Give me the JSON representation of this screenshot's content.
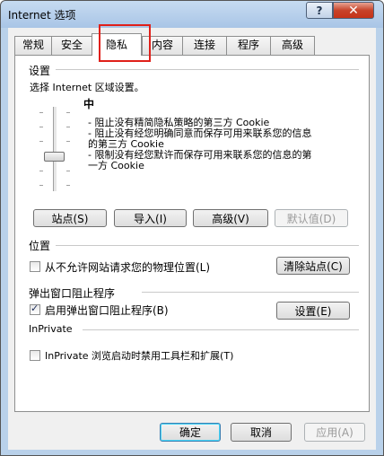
{
  "window": {
    "title": "Internet 选项",
    "help_label": "?",
    "close_label": "✕"
  },
  "tabs": [
    {
      "label": "常规"
    },
    {
      "label": "安全"
    },
    {
      "label": "隐私",
      "active": true
    },
    {
      "label": "内容"
    },
    {
      "label": "连接"
    },
    {
      "label": "程序"
    },
    {
      "label": "高级"
    }
  ],
  "settings": {
    "group_label": "设置",
    "zone_text": "选择 Internet 区域设置。",
    "level_label": "中",
    "slider_level": "中",
    "descriptions": [
      "- 阻止没有精简隐私策略的第三方 Cookie",
      "- 阻止没有经您明确同意而保存可用来联系您的信息",
      "的第三方 Cookie",
      "- 限制没有经您默许而保存可用来联系您的信息的第",
      "一方 Cookie"
    ],
    "buttons": {
      "sites": "站点(S)",
      "import": "导入(I)",
      "advanced": "高级(V)",
      "default": "默认值(D)"
    }
  },
  "location": {
    "group_label": "位置",
    "checkbox_label": "从不允许网站请求您的物理位置(L)",
    "checkbox_checked": false,
    "clear_button": "清除站点(C)"
  },
  "popup": {
    "group_label": "弹出窗口阻止程序",
    "checkbox_label": "启用弹出窗口阻止程序(B)",
    "checkbox_checked": true,
    "settings_button": "设置(E)"
  },
  "inprivate": {
    "group_label": "InPrivate",
    "checkbox_label": "InPrivate 浏览启动时禁用工具栏和扩展(T)",
    "checkbox_checked": false
  },
  "footer": {
    "ok": "确定",
    "cancel": "取消",
    "apply": "应用(A)"
  },
  "colors": {
    "highlight": "#e0201a",
    "title_bg": "#b9d1ea"
  }
}
